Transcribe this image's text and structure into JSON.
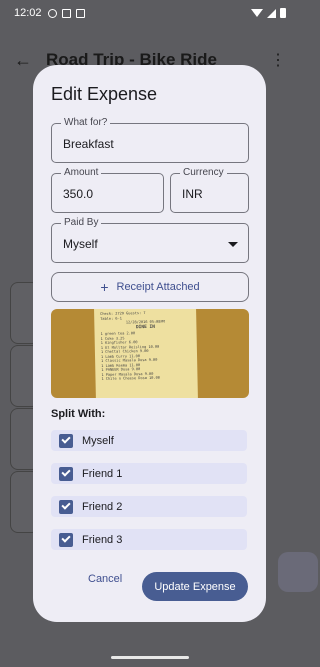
{
  "status_bar": {
    "time": "12:02"
  },
  "background": {
    "title": "Road Trip - Bike Ride"
  },
  "dialog": {
    "title": "Edit Expense",
    "what_for": {
      "label": "What for?",
      "value": "Breakfast"
    },
    "amount": {
      "label": "Amount",
      "value": "350.0"
    },
    "currency": {
      "label": "Currency",
      "value": "INR"
    },
    "paid_by": {
      "label": "Paid By",
      "value": "Myself"
    },
    "receipt_button": "Receipt Attached",
    "receipt_lines": [
      "Check: 2729        Guests: 7",
      "Table: 6-1",
      "12/28/2016 05:08PM",
      "DINE IN",
      "1   green tea              2.00",
      "1   Coke                   3.25",
      "1   Kingfisher             6.00",
      "1   El Molltar Reisling   10.00",
      "1   Chettal Chicken        9.00",
      "1   Lamb Curry            11.00",
      "1   Classic Masala Dosa    9.00",
      "1   Lamb Keema            11.00",
      "1   PANEER Dosa            9.00",
      "1   Paper Masala Dosa      9.00",
      "1   Chile n Cheese Dosa   10.00"
    ],
    "split_label": "Split With:",
    "split_items": [
      {
        "name": "Myself",
        "checked": true
      },
      {
        "name": "Friend 1",
        "checked": true
      },
      {
        "name": "Friend 2",
        "checked": true
      },
      {
        "name": "Friend 3",
        "checked": true
      }
    ],
    "cancel": "Cancel",
    "update": "Update Expense"
  }
}
